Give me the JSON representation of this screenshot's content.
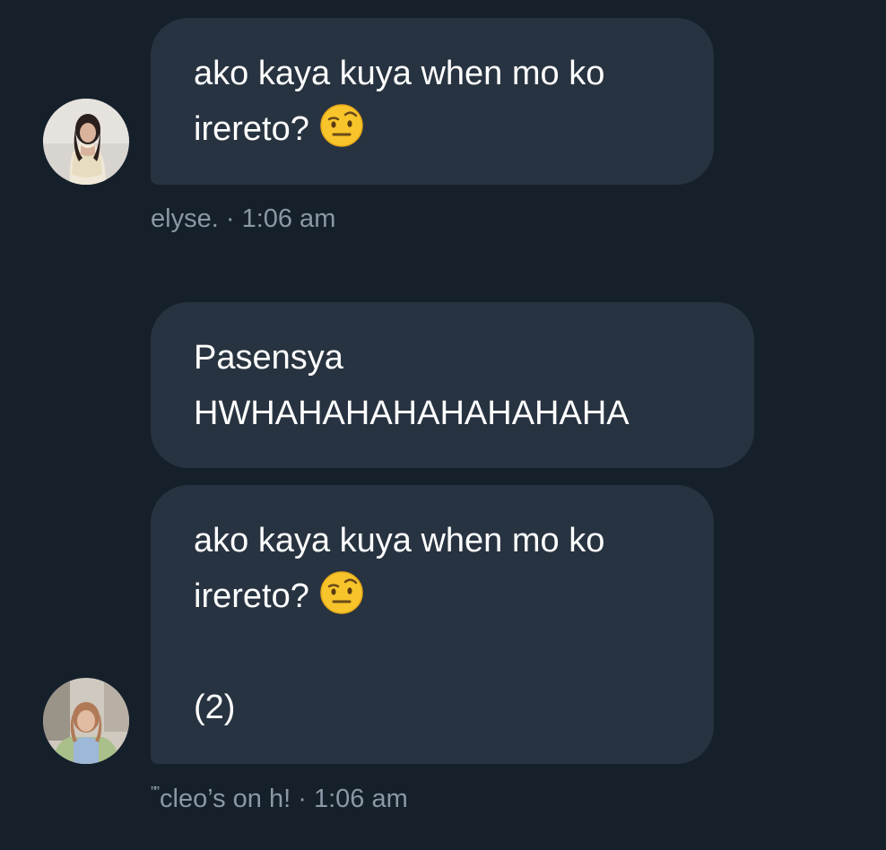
{
  "messages": [
    {
      "lines": [
        "ako kaya kuya when mo ko",
        "irereto?"
      ],
      "emoji": "face-with-raised-eyebrow-icon"
    },
    {
      "lines": [
        "Pasensya",
        "HWHAHAHAHAHAHAHAHA"
      ]
    },
    {
      "lines": [
        "ako kaya kuya when mo ko",
        "irereto?",
        "",
        "(2)"
      ],
      "emoji": "face-with-raised-eyebrow-icon"
    }
  ],
  "meta": [
    {
      "sender": "elyse.",
      "separator": "·",
      "time": "1:06 am"
    },
    {
      "sender": "cleo’s on h!",
      "separator": "·",
      "time": "1:06 am"
    }
  ],
  "colors": {
    "background": "#15202b",
    "bubble": "#273340",
    "meta_text": "#8b98a5"
  }
}
